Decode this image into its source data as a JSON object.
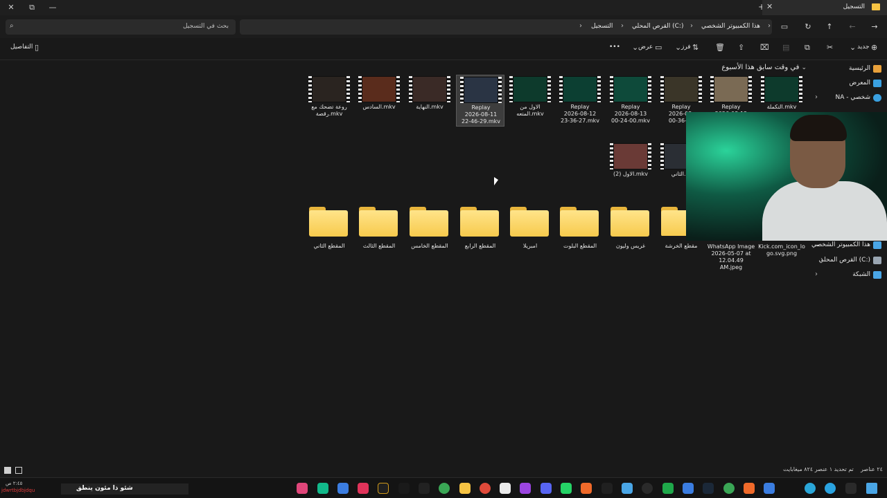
{
  "window": {
    "tab_title": "التسجيل",
    "minimize": "—",
    "maximize": "⧉",
    "close": "✕"
  },
  "address": {
    "search_placeholder": "بحث في التسجيل",
    "crumbs": [
      "هذا الكمبيوتر الشخصي",
      "القرص المحلي (C:)",
      "التسجيل"
    ]
  },
  "commands": {
    "new": "جديد",
    "sort": "فرز",
    "view": "عرض",
    "more": "•••",
    "details": "التفاصيل"
  },
  "sidebar": {
    "items": [
      {
        "label": "الرئيسية",
        "icon": "home-icon",
        "color": "#e9a13b"
      },
      {
        "label": "المعرض",
        "icon": "gallery-icon",
        "color": "#3aa0e0"
      },
      {
        "label": "NA - شخصي",
        "icon": "onedrive-icon",
        "color": "#3aa0e0"
      },
      {
        "label": "هذا الكمبيوتر الشخصي",
        "icon": "computer-icon",
        "color": "#4aa6e6"
      },
      {
        "label": "القرص المحلي (C:)",
        "icon": "drive-icon",
        "color": "#9aa6b2"
      },
      {
        "label": "الشبكة",
        "icon": "network-icon",
        "color": "#4aa6e6"
      }
    ]
  },
  "group": {
    "title": "في وقت سابق هذا الأسبوع"
  },
  "files": [
    {
      "name": "التكملة.mkv",
      "color": "#0d3a2c"
    },
    {
      "name": "Replay\n2026-08-12",
      "color": "#7a6a54"
    },
    {
      "name": "Replay\n2026-08-\n00-36-30",
      "color": "#3a3528"
    },
    {
      "name": "Replay\n2026-08-13\n00-24-00.mkv",
      "color": "#0e4a3a"
    },
    {
      "name": "Replay\n2026-08-12\n23-36-27.mkv",
      "color": "#0c3f32"
    },
    {
      "name": "الاول من\nالمتعه.mkv",
      "color": "#0d3a2c"
    },
    {
      "name": "Replay\n2026-08-11\n22-46-29.mkv",
      "color": "#2a3444"
    },
    {
      "name": "النهاية.mkv",
      "color": "#3a2a26"
    },
    {
      "name": "السادس.mkv",
      "color": "#5a2c1c"
    },
    {
      "name": "روعة تضحك مع\nرقصة.mkv",
      "color": "#2a2420"
    },
    {
      "name": "الاول (2).mkv",
      "color": "#6a3a36"
    },
    {
      "name": "الثاني.m",
      "color": "#2a2e34"
    }
  ],
  "folders": [
    "المقطع الثاني",
    "المقطع الثالث",
    "المقطع الخامس",
    "المقطع الرابع",
    "امبريلا",
    "المقطع البلوت",
    "غريس وليون",
    "مقطع الخرشة"
  ],
  "loose_files": [
    {
      "name": "WhatsApp Image\n2026-05-07 at\n12.04.49 AM.jpeg"
    },
    {
      "name": "Kick.com_icon_lo\ngo.svg.png"
    }
  ],
  "status": {
    "count": "٢٤ عناصر",
    "selected": "تم تحديد ١ عنصر  ٨٢٤ ميغابايت"
  },
  "taskbar": {
    "media_text": "شئو ذا مئون ينطق",
    "tray_text": "jdwrtbjdbjdqu",
    "clock": "٢:٤٥ ص"
  }
}
